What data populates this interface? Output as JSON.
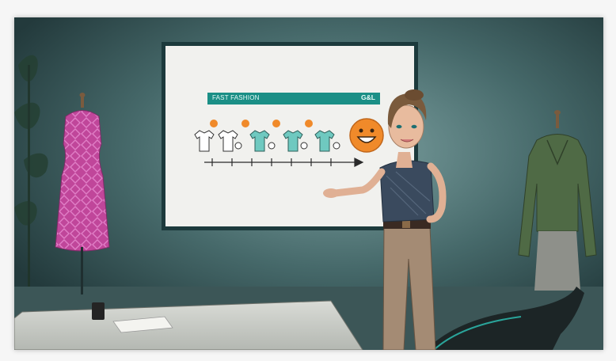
{
  "whiteboard": {
    "title": "FAST FASHION",
    "brand": "G&L"
  },
  "colors": {
    "teal": "#1b8f86",
    "emoji_orange": "#f08a2a",
    "dress_pink": "#c0469a",
    "sweater_green": "#4f6a45",
    "room_dark": "#2f4a4c"
  },
  "icons": [
    "shirt-icon",
    "smiley-icon",
    "arrow-icon"
  ]
}
